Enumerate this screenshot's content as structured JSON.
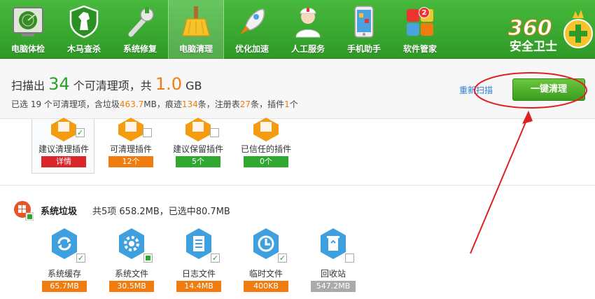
{
  "nav": [
    {
      "label": "电脑体检",
      "icon": "radar-screen-icon"
    },
    {
      "label": "木马查杀",
      "icon": "horse-shield-icon"
    },
    {
      "label": "系统修复",
      "icon": "wrench-icon"
    },
    {
      "label": "电脑清理",
      "icon": "broom-icon",
      "active": true
    },
    {
      "label": "优化加速",
      "icon": "rocket-icon"
    },
    {
      "label": "人工服务",
      "icon": "doctor-icon"
    },
    {
      "label": "手机助手",
      "icon": "phone-icon"
    },
    {
      "label": "软件管家",
      "icon": "app-grid-icon",
      "badge": "2"
    }
  ],
  "brand": {
    "logo_text": "360",
    "sub_text": "安全卫士"
  },
  "summary": {
    "prefix": "扫描出",
    "count": "34",
    "mid": "个可清理项，共",
    "size": "1.0",
    "unit": "GB",
    "detail": {
      "selected_prefix": "已选 19 个可清理项，含垃圾",
      "junk": "463.7",
      "junk_unit": "MB，痕迹",
      "traces": "134",
      "traces_unit": "条，注册表",
      "registry": "27",
      "registry_unit": "条，插件",
      "plugins": "1",
      "plugins_unit": "个"
    }
  },
  "actions": {
    "rescan": "重新扫描",
    "clean": "一键清理"
  },
  "plugins": [
    {
      "name": "建议清理插件",
      "tag": "详情",
      "tag_color": "red",
      "checked": true
    },
    {
      "name": "可清理插件",
      "tag": "12个",
      "tag_color": "orange",
      "checked": false
    },
    {
      "name": "建议保留插件",
      "tag": "5个",
      "tag_color": "green",
      "checked": false
    },
    {
      "name": "已信任的插件",
      "tag": "0个",
      "tag_color": "green",
      "checked": false
    }
  ],
  "system_junk": {
    "title": "系统垃圾",
    "info": "共5项 658.2MB，已选中80.7MB",
    "items": [
      {
        "name": "系统缓存",
        "size": "65.7MB",
        "tag_color": "orange",
        "icon": "refresh-icon",
        "check": "checked"
      },
      {
        "name": "系统文件",
        "size": "30.5MB",
        "tag_color": "orange",
        "icon": "gear-icon",
        "check": "partial"
      },
      {
        "name": "日志文件",
        "size": "14.4MB",
        "tag_color": "orange",
        "icon": "document-icon",
        "check": "checked"
      },
      {
        "name": "临时文件",
        "size": "400KB",
        "tag_color": "orange",
        "icon": "clock-icon",
        "check": "checked"
      },
      {
        "name": "回收站",
        "size": "547.2MB",
        "tag_color": "gray",
        "icon": "recycle-bin-icon",
        "check": "unchecked"
      }
    ]
  }
}
